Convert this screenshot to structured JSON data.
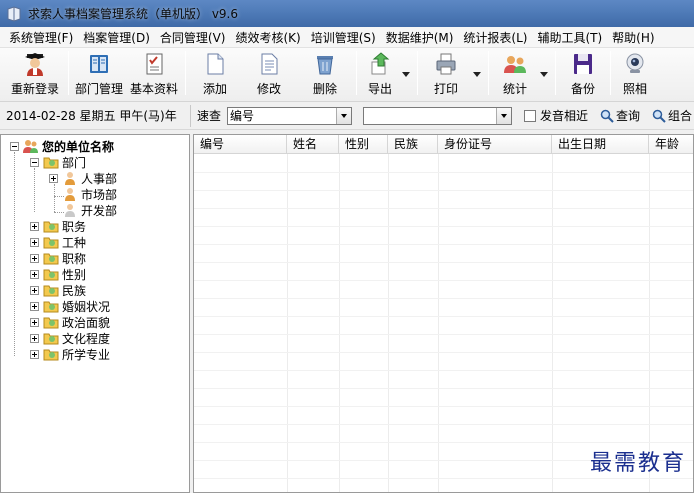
{
  "window": {
    "title": "求索人事档案管理系统（单机版） v9.6"
  },
  "menu": [
    "系统管理(F)",
    "档案管理(D)",
    "合同管理(V)",
    "绩效考核(K)",
    "培训管理(S)",
    "数据维护(M)",
    "统计报表(L)",
    "辅助工具(T)",
    "帮助(H)"
  ],
  "toolbar": {
    "relogin": "重新登录",
    "dept": "部门管理",
    "basic": "基本资料",
    "add": "添加",
    "edit": "修改",
    "delete": "删除",
    "export": "导出",
    "print": "打印",
    "stats": "统计",
    "backup": "备份",
    "photo": "照相"
  },
  "search": {
    "date": "2014-02-28 星期五 甲午(马)年",
    "quick_label": "速查",
    "field": "编号",
    "value": "",
    "similar_label": "发音相近",
    "query": "查询",
    "combined": "组合"
  },
  "tree": {
    "root": "您的单位名称",
    "dept": "部门",
    "depts": [
      "人事部",
      "市场部",
      "开发部"
    ],
    "categories": [
      "职务",
      "工种",
      "职称",
      "性别",
      "民族",
      "婚姻状况",
      "政治面貌",
      "文化程度",
      "所学专业"
    ]
  },
  "grid": {
    "columns": [
      "编号",
      "姓名",
      "性别",
      "民族",
      "身份证号",
      "出生日期",
      "年龄"
    ]
  },
  "watermark": "最需教育"
}
